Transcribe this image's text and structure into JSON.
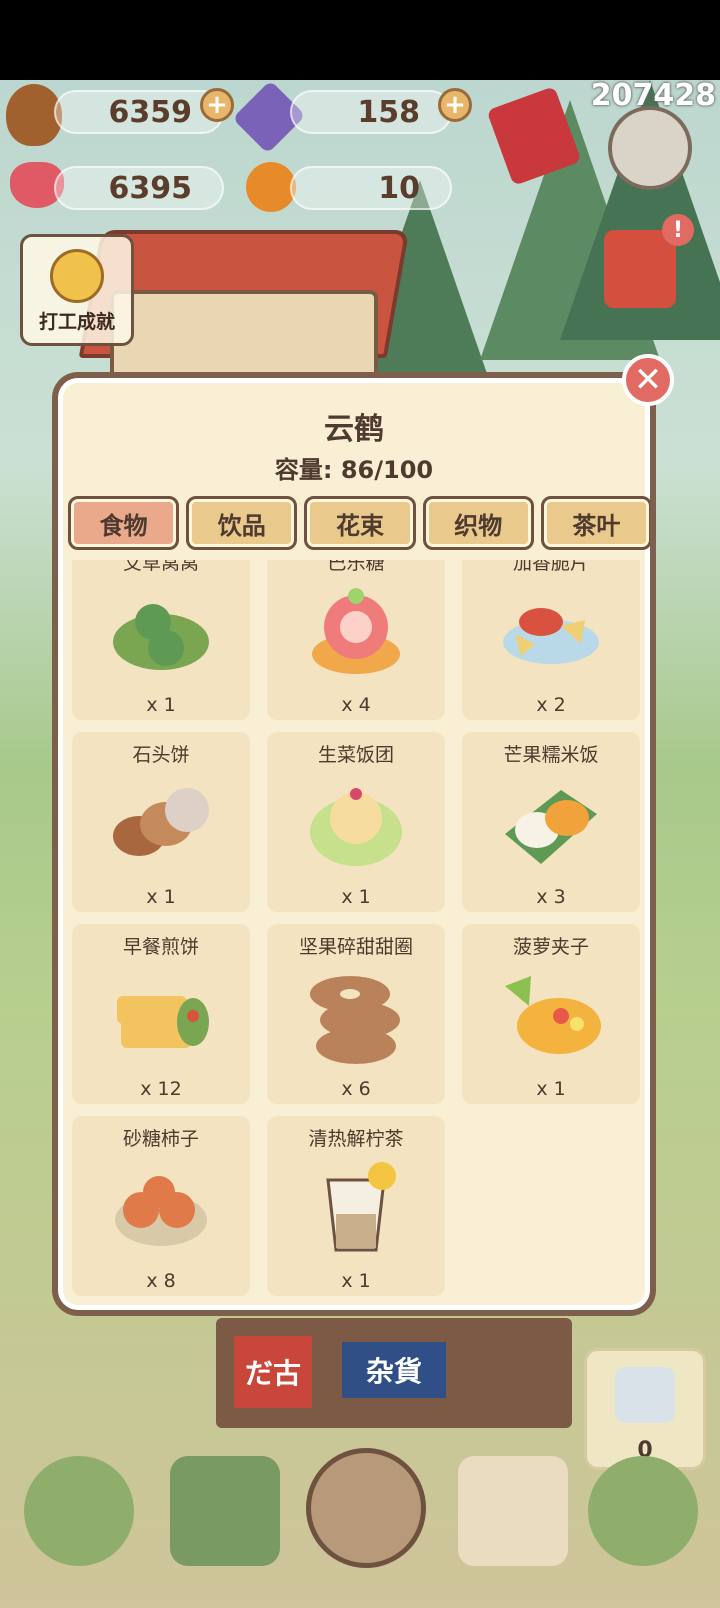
{
  "resources": {
    "acorns": "6359",
    "gems": "158",
    "hearts": "6395",
    "oranges": "10",
    "score": "207428"
  },
  "achievement_label": "打工成就",
  "panel": {
    "title": "云鹤",
    "capacity": "容量: 86/100",
    "tabs": [
      "食物",
      "饮品",
      "花束",
      "织物",
      "茶叶"
    ],
    "active_tab": "食物",
    "items": [
      {
        "name": "艾草窝窝",
        "qty": "x 1",
        "icon": "mugwort-dumpling"
      },
      {
        "name": "巴乐糖",
        "qty": "x 4",
        "icon": "guava-tart"
      },
      {
        "name": "加香脆片",
        "qty": "x 2",
        "icon": "chips-with-dip"
      },
      {
        "name": "石头饼",
        "qty": "x 1",
        "icon": "stone-cakes"
      },
      {
        "name": "生菜饭团",
        "qty": "x 1",
        "icon": "lettuce-rice-ball"
      },
      {
        "name": "芒果糯米饭",
        "qty": "x 3",
        "icon": "mango-sticky-rice"
      },
      {
        "name": "早餐煎饼",
        "qty": "x 12",
        "icon": "breakfast-pancake"
      },
      {
        "name": "坚果碎甜甜圈",
        "qty": "x 6",
        "icon": "nut-donuts"
      },
      {
        "name": "菠萝夹子",
        "qty": "x 1",
        "icon": "pineapple-boat"
      },
      {
        "name": "砂糖柿子",
        "qty": "x 8",
        "icon": "sugar-persimmons"
      },
      {
        "name": "清热解柠茶",
        "qty": "x 1",
        "icon": "lemon-tea"
      }
    ]
  },
  "shop_signs": {
    "left": "だ古",
    "right": "杂貨"
  },
  "gift_count": "0"
}
